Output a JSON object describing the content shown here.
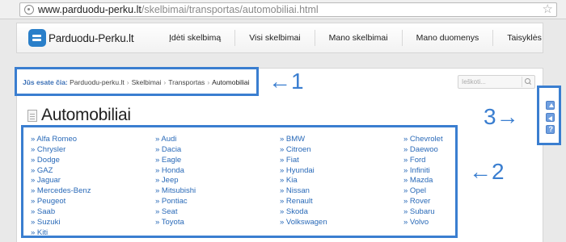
{
  "browser": {
    "url_domain": "www.parduodu-perku.lt",
    "url_path": "/skelbimai/transportas/automobiliai.html"
  },
  "site": {
    "logo_text": "Parduodu-Perku.lt",
    "nav": [
      "Įdėti skelbimą",
      "Visi skelbimai",
      "Mano skelbimai",
      "Mano duomenys",
      "Taisyklės"
    ]
  },
  "breadcrumb": {
    "lead": "Jūs esate čia:",
    "items": [
      "Parduodu-perku.lt",
      "Skelbimai",
      "Transportas",
      "Automobiliai"
    ],
    "separator": "›"
  },
  "search": {
    "placeholder": "Ieškoti..."
  },
  "page_title": "Automobiliai",
  "brands": {
    "col1": [
      "» Alfa Romeo",
      "» Chrysler",
      "» Dodge",
      "» GAZ",
      "» Jaguar",
      "» Mercedes-Benz",
      "» Peugeot",
      "» Saab",
      "» Suzuki",
      "» Kiti"
    ],
    "col2": [
      "» Audi",
      "» Dacia",
      "» Eagle",
      "» Honda",
      "» Jeep",
      "» Mitsubishi",
      "» Pontiac",
      "» Seat",
      "» Toyota"
    ],
    "col3": [
      "» BMW",
      "» Citroen",
      "» Fiat",
      "» Hyundai",
      "» Kia",
      "» Nissan",
      "» Renault",
      "» Skoda",
      "» Volkswagen"
    ],
    "col4": [
      "» Chevrolet",
      "» Daewoo",
      "» Ford",
      "» Infiniti",
      "» Mazda",
      "» Opel",
      "» Rover",
      "» Subaru",
      "» Volvo"
    ]
  },
  "annotations": {
    "a1": "←1",
    "a2": "←2",
    "a3": "3→"
  },
  "colors": {
    "accent": "#3a7ed0",
    "link": "#2a6ab8"
  }
}
